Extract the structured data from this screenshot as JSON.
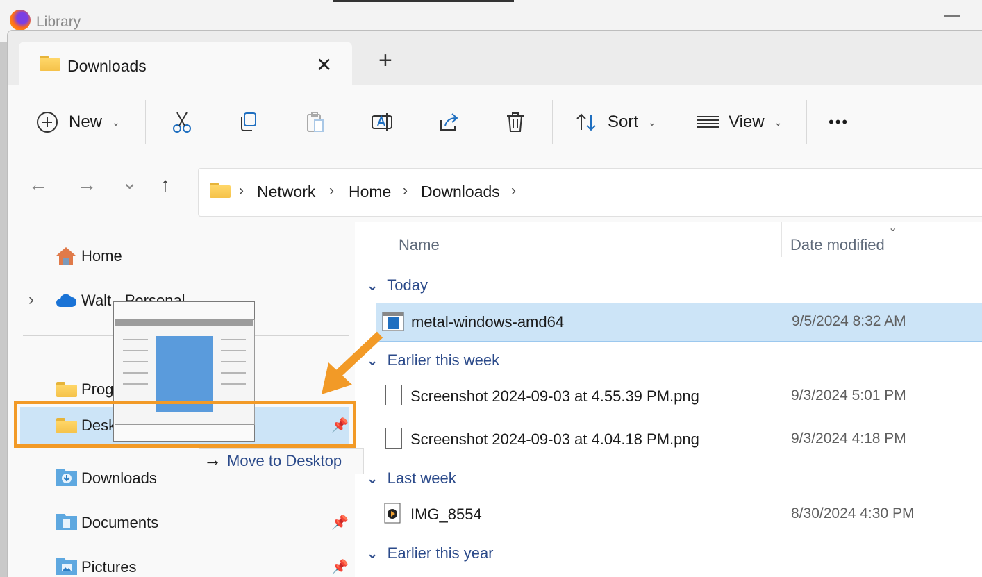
{
  "background_window": {
    "title": "Library"
  },
  "tab": {
    "label": "Downloads",
    "close_glyph": "✕",
    "new_tab_glyph": "+"
  },
  "toolbar": {
    "new_label": "New",
    "sort_label": "Sort",
    "view_label": "View",
    "more_glyph": "•••",
    "chevron": "⌄"
  },
  "nav": {
    "back": "←",
    "forward": "→",
    "recent": "⌄",
    "up": "↑"
  },
  "breadcrumb": {
    "items": [
      "Network",
      "Home",
      "Downloads"
    ],
    "separator": "›"
  },
  "sidebar": {
    "items": [
      {
        "label": "Home"
      },
      {
        "label": "Walt - Personal",
        "expander": "›"
      },
      {
        "label": "Prog"
      },
      {
        "label": "Desk"
      },
      {
        "label": "Downloads"
      },
      {
        "label": "Documents"
      },
      {
        "label": "Pictures"
      }
    ],
    "pin_glyph": "📌"
  },
  "columns": {
    "name": "Name",
    "date": "Date modified",
    "sort_indicator": "⌄"
  },
  "groups": [
    {
      "label": "Today",
      "chevron": "⌄"
    },
    {
      "label": "Earlier this week",
      "chevron": "⌄"
    },
    {
      "label": "Last week",
      "chevron": "⌄"
    },
    {
      "label": "Earlier this year",
      "chevron": "⌄"
    }
  ],
  "files": [
    {
      "name": "metal-windows-amd64",
      "date": "9/5/2024 8:32 AM",
      "selected": true
    },
    {
      "name": "Screenshot 2024-09-03 at 4.55.39 PM.png",
      "date": "9/3/2024 5:01 PM"
    },
    {
      "name": "Screenshot 2024-09-03 at 4.04.18 PM.png",
      "date": "9/3/2024 4:18 PM"
    },
    {
      "name": "IMG_8554",
      "date": "8/30/2024 4:30 PM"
    }
  ],
  "drag_tooltip": {
    "arrow": "→",
    "text": "Move to Desktop"
  },
  "colors": {
    "highlight": "#f29a27",
    "selection": "#cce4f7",
    "group_text": "#2b4a8a"
  }
}
